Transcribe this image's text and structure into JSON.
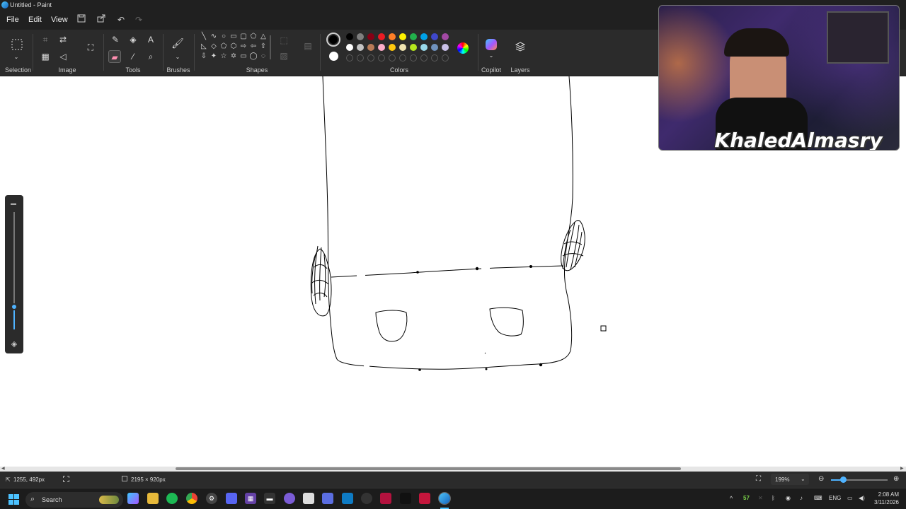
{
  "window": {
    "title": "Untitled - Paint"
  },
  "menu": {
    "file": "File",
    "edit": "Edit",
    "view": "View"
  },
  "ribbon": {
    "groups": {
      "selection": "Selection",
      "image": "Image",
      "tools": "Tools",
      "brushes": "Brushes",
      "shapes": "Shapes",
      "colors": "Colors",
      "copilot": "Copilot",
      "layers": "Layers"
    },
    "active_tool": "eraser",
    "color1": "#000000",
    "color2": "#ffffff",
    "palette_row1": [
      "#000000",
      "#7f7f7f",
      "#880015",
      "#ed1c24",
      "#ff7f27",
      "#fff200",
      "#22b14c",
      "#00a2e8",
      "#3f48cc",
      "#a349a4"
    ],
    "palette_row2": [
      "#ffffff",
      "#c3c3c3",
      "#b97a57",
      "#ffaec9",
      "#ffc90e",
      "#efe4b0",
      "#b5e61d",
      "#99d9ea",
      "#7092be",
      "#c8bfe7"
    ]
  },
  "webcam": {
    "name": "KhaledAlmasry"
  },
  "status": {
    "cursor_pos": "1255, 492px",
    "canvas_size": "2195 × 920px",
    "zoom": "199%"
  },
  "taskbar": {
    "search": "Search",
    "tray_count": "57",
    "lang": "ENG",
    "time": "2:08 AM",
    "date": "3/11/2026"
  }
}
